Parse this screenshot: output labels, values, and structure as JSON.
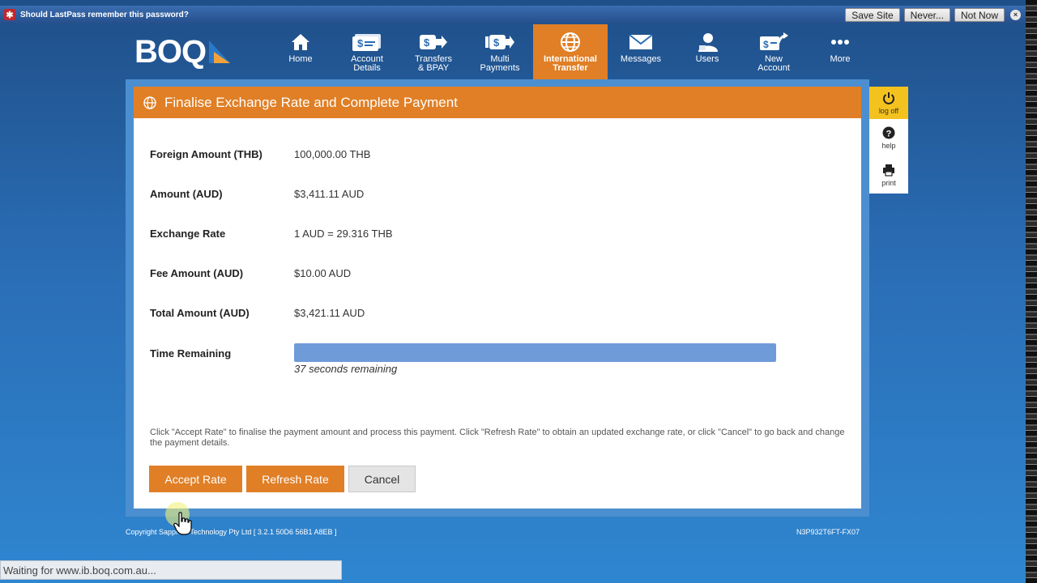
{
  "lastpass": {
    "prompt": "Should LastPass remember this password?",
    "save_site": "Save Site",
    "never": "Never...",
    "not_now": "Not Now",
    "close": "×"
  },
  "brand": {
    "logo_text": "BOQ",
    "accent": "#e07f26"
  },
  "nav": {
    "items": [
      {
        "label": "Home",
        "icon": "home-icon"
      },
      {
        "label": "Account\nDetails",
        "icon": "account-details-icon"
      },
      {
        "label": "Transfers\n& BPAY",
        "icon": "transfer-icon"
      },
      {
        "label": "Multi\nPayments",
        "icon": "multi-payments-icon"
      },
      {
        "label": "International\nTransfer",
        "icon": "globe-icon",
        "active": true
      },
      {
        "label": "Messages",
        "icon": "envelope-icon"
      },
      {
        "label": "Users",
        "icon": "users-icon"
      },
      {
        "label": "New\nAccount",
        "icon": "new-account-icon"
      },
      {
        "label": "More",
        "icon": "more-icon"
      }
    ]
  },
  "panel": {
    "title": "Finalise Exchange Rate and Complete Payment",
    "fields": [
      {
        "label": "Foreign Amount (THB)",
        "value": "100,000.00 THB"
      },
      {
        "label": "Amount (AUD)",
        "value": "$3,411.11 AUD"
      },
      {
        "label": "Exchange Rate",
        "value": "1 AUD = 29.316 THB"
      },
      {
        "label": "Fee Amount (AUD)",
        "value": "$10.00 AUD"
      },
      {
        "label": "Total Amount (AUD)",
        "value": "$3,421.11 AUD"
      }
    ],
    "time_remaining_label": "Time Remaining",
    "time_remaining_fraction": 1.0,
    "time_remaining_text": "37 seconds remaining",
    "help_text": "Click \"Accept Rate\" to finalise the payment amount and process this payment. Click \"Refresh Rate\" to obtain an updated exchange rate, or click \"Cancel\" to go back and change the payment details.",
    "buttons": {
      "accept": "Accept Rate",
      "refresh": "Refresh Rate",
      "cancel": "Cancel"
    }
  },
  "tools": {
    "logoff": "log off",
    "help": "help",
    "print": "print"
  },
  "footer": {
    "copyright": "Copyright Sapphire Technology Pty Ltd [ 3.2.1 50D6 56B1 A8EB ]",
    "code": "N3P932T6FT-FX07"
  },
  "status_bar": "Waiting for www.ib.boq.com.au..."
}
